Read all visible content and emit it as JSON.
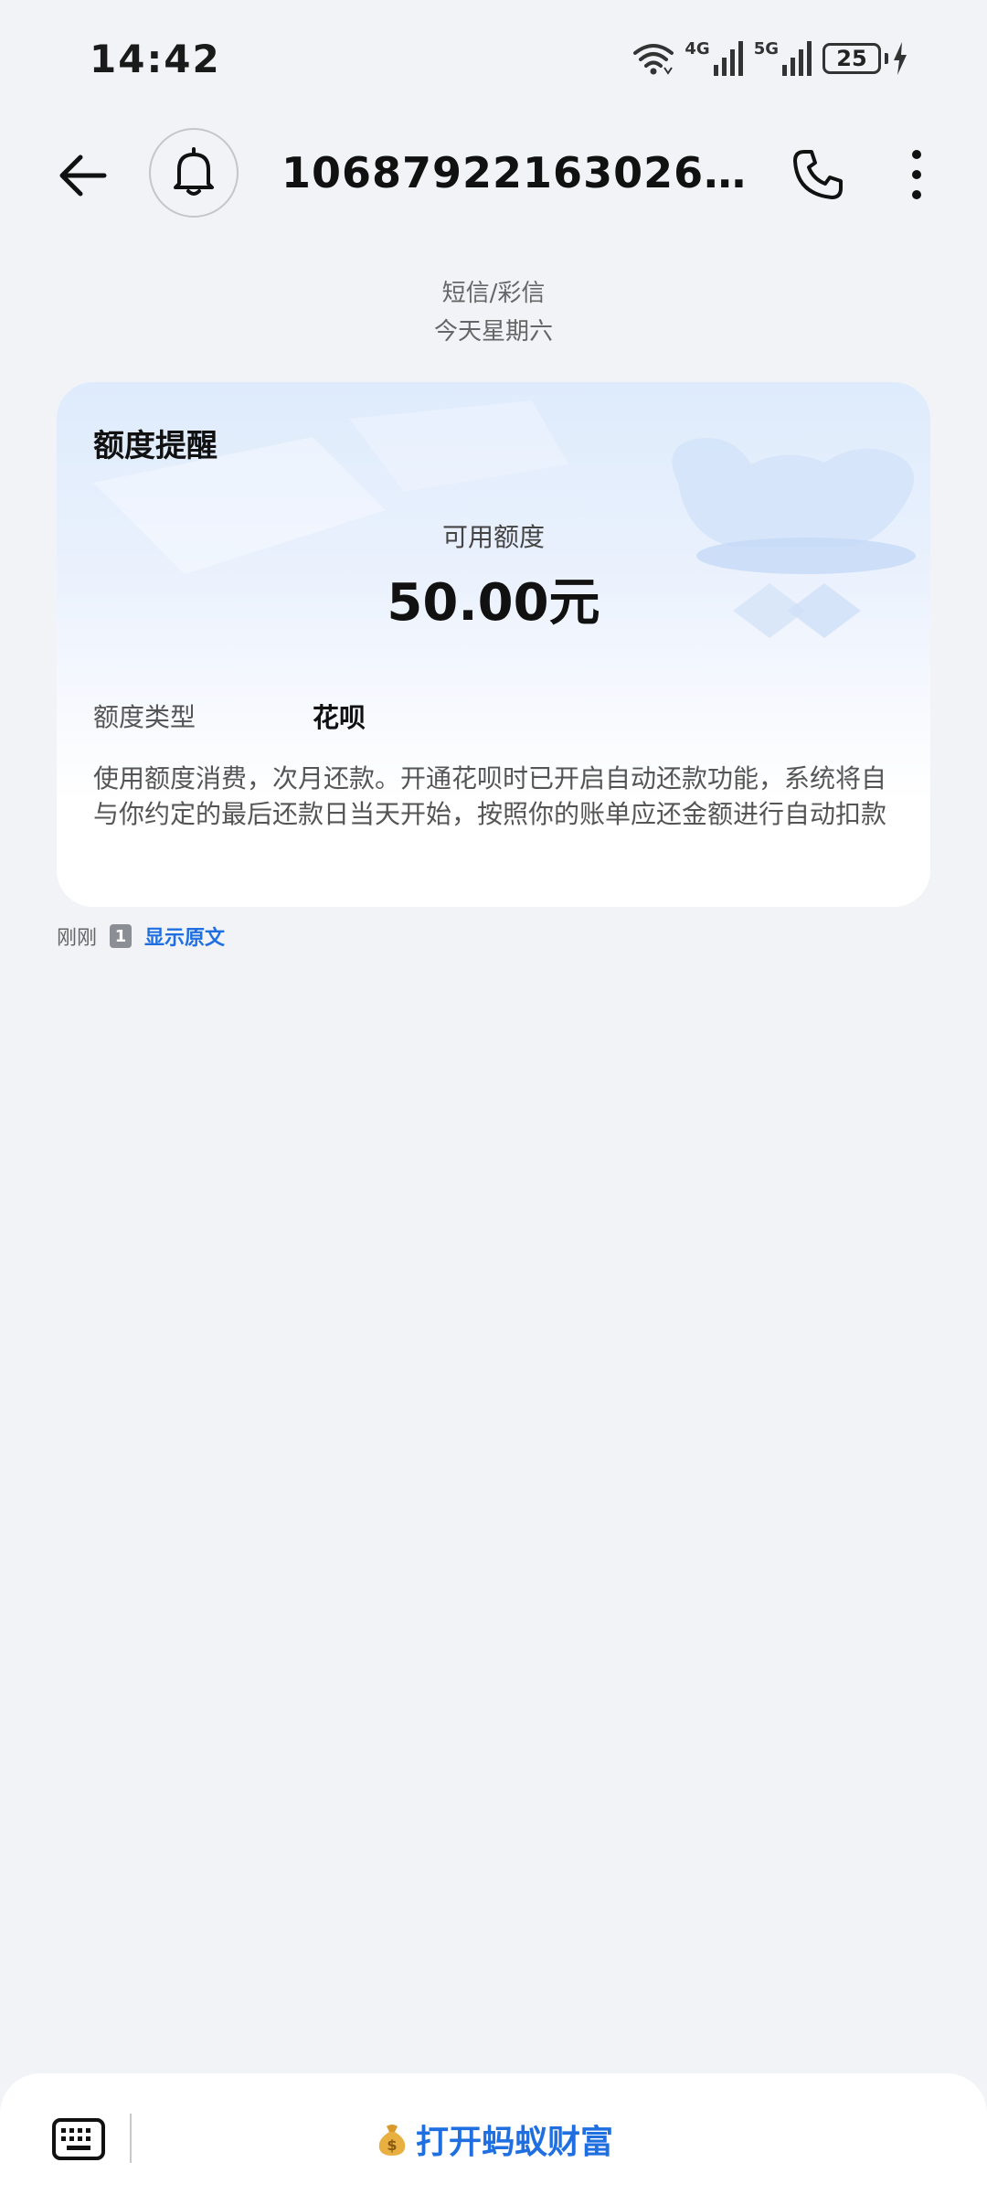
{
  "status_bar": {
    "time": "14:42",
    "network_1": "4G",
    "network_2": "5G",
    "battery_level": "25"
  },
  "app_bar": {
    "sender": "106879221630260000..."
  },
  "meta": {
    "message_type": "短信/彩信",
    "date": "今天星期六"
  },
  "card": {
    "title": "额度提醒",
    "available_label": "可用额度",
    "available_amount": "50.00元",
    "type_label": "额度类型",
    "type_value": "花呗",
    "description": "使用额度消费，次月还款。开通花呗时已开启自动还款功能，系统将自与你约定的最后还款日当天开始，按照你的账单应还金额进行自动扣款"
  },
  "message_footer": {
    "time": "刚刚",
    "sim": "1",
    "show_original": "显示原文"
  },
  "bottom_bar": {
    "action_label": "打开蚂蚁财富"
  },
  "colors": {
    "accent": "#1f6fe0",
    "background": "#f1f3f7",
    "card_top": "#deebfc"
  }
}
